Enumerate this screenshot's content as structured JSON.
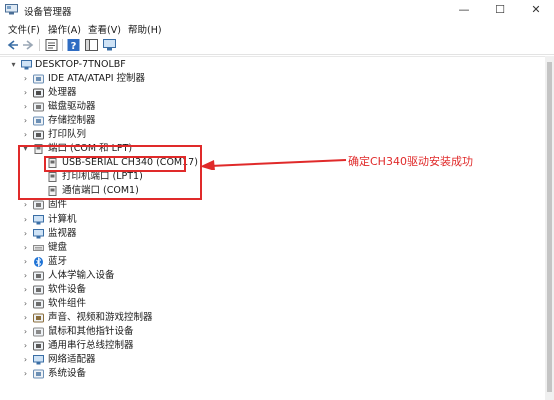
{
  "window": {
    "title": "设备管理器",
    "minimize": "—",
    "maximize": "☐",
    "close": "✕"
  },
  "menu": [
    "文件(F)",
    "操作(A)",
    "查看(V)",
    "帮助(H)"
  ],
  "toolbar": [
    "back-icon",
    "forward-icon",
    "properties-icon",
    "help-icon",
    "console-icon",
    "monitor-icon"
  ],
  "tree": {
    "root": "DESKTOP-7TNOLBF",
    "categories": [
      {
        "label": "IDE ATA/ATAPI 控制器",
        "icon": "ide-controller-icon"
      },
      {
        "label": "处理器",
        "icon": "processor-icon"
      },
      {
        "label": "磁盘驱动器",
        "icon": "disk-drive-icon"
      },
      {
        "label": "存储控制器",
        "icon": "storage-controller-icon"
      },
      {
        "label": "打印队列",
        "icon": "print-queue-icon"
      },
      {
        "label": "端口 (COM 和 LPT)",
        "icon": "port-icon",
        "expanded": true,
        "children": [
          {
            "label": "USB-SERIAL CH340 (COM17)",
            "icon": "port-device-icon"
          },
          {
            "label": "打印机端口 (LPT1)",
            "icon": "port-device-icon"
          },
          {
            "label": "通信端口 (COM1)",
            "icon": "port-device-icon"
          }
        ]
      },
      {
        "label": "固件",
        "icon": "firmware-icon"
      },
      {
        "label": "计算机",
        "icon": "computer-icon"
      },
      {
        "label": "监视器",
        "icon": "monitor-icon"
      },
      {
        "label": "键盘",
        "icon": "keyboard-icon"
      },
      {
        "label": "蓝牙",
        "icon": "bluetooth-icon"
      },
      {
        "label": "人体学输入设备",
        "icon": "hid-icon"
      },
      {
        "label": "软件设备",
        "icon": "software-device-icon"
      },
      {
        "label": "软件组件",
        "icon": "software-component-icon"
      },
      {
        "label": "声音、视频和游戏控制器",
        "icon": "sound-icon"
      },
      {
        "label": "鼠标和其他指针设备",
        "icon": "mouse-icon"
      },
      {
        "label": "通用串行总线控制器",
        "icon": "usb-icon"
      },
      {
        "label": "网络适配器",
        "icon": "network-adapter-icon"
      },
      {
        "label": "系统设备",
        "icon": "system-device-icon"
      }
    ]
  },
  "annotation": {
    "text": "确定CH340驱动安装成功",
    "color": "#e02a2a"
  }
}
